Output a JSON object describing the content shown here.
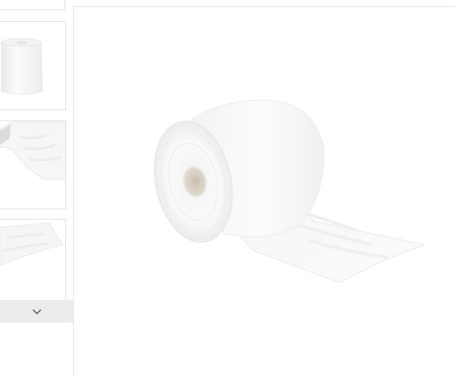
{
  "gallery": {
    "thumbnails": [
      {
        "icon": "paper-roll-front-thumbnail"
      },
      {
        "icon": "paper-roll-sheet-detail-thumbnail"
      },
      {
        "icon": "paper-roll-sheet-edge-thumbnail"
      }
    ],
    "scroll_down_icon": "chevron-down-icon",
    "main_image_icon": "paper-roll-product-image"
  },
  "colors": {
    "border": "#e2e2e2",
    "scroll_button_bg": "#ececec",
    "paper_white": "#f7f7f7",
    "roll_core": "#d8d0c2"
  }
}
